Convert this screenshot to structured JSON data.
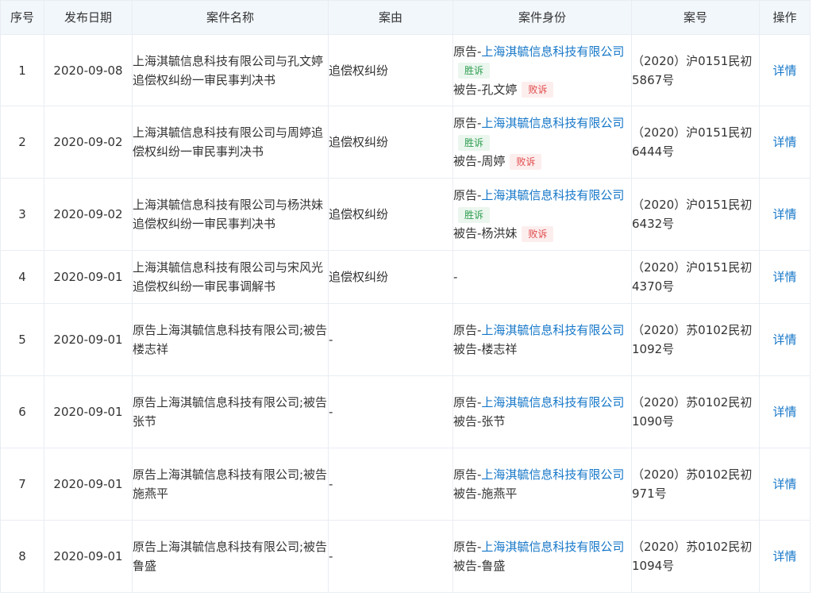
{
  "headers": {
    "idx": "序号",
    "date": "发布日期",
    "name": "案件名称",
    "reason": "案由",
    "role": "案件身份",
    "caseno": "案号",
    "op": "操作"
  },
  "rows": [
    {
      "idx": "1",
      "date": "2020-09-08",
      "name": "上海淇毓信息科技有限公司与孔文婷追偿权纠纷一审民事判决书",
      "reason": "追偿权纠纷",
      "plaintiff_prefix": "原告-",
      "plaintiff": "上海淇毓信息科技有限公司",
      "plaintiff_tag": "胜诉",
      "defendant": "被告-孔文婷",
      "defendant_tag": "败诉",
      "role_text": "",
      "caseno": "（2020）沪0151民初5867号",
      "op": "详情"
    },
    {
      "idx": "2",
      "date": "2020-09-02",
      "name": "上海淇毓信息科技有限公司与周婷追偿权纠纷一审民事判决书",
      "reason": "追偿权纠纷",
      "plaintiff_prefix": "原告-",
      "plaintiff": "上海淇毓信息科技有限公司",
      "plaintiff_tag": "胜诉",
      "defendant": "被告-周婷",
      "defendant_tag": "败诉",
      "role_text": "",
      "caseno": "（2020）沪0151民初6444号",
      "op": "详情"
    },
    {
      "idx": "3",
      "date": "2020-09-02",
      "name": "上海淇毓信息科技有限公司与杨洪妹追偿权纠纷一审民事判决书",
      "reason": "追偿权纠纷",
      "plaintiff_prefix": "原告-",
      "plaintiff": "上海淇毓信息科技有限公司",
      "plaintiff_tag": "胜诉",
      "defendant": "被告-杨洪妹",
      "defendant_tag": "败诉",
      "role_text": "",
      "caseno": "（2020）沪0151民初6432号",
      "op": "详情"
    },
    {
      "idx": "4",
      "date": "2020-09-01",
      "name": "上海淇毓信息科技有限公司与宋风光追偿权纠纷一审民事调解书",
      "reason": "追偿权纠纷",
      "plaintiff_prefix": "",
      "plaintiff": "",
      "plaintiff_tag": "",
      "defendant": "",
      "defendant_tag": "",
      "role_text": "-",
      "caseno": "（2020）沪0151民初4370号",
      "op": "详情"
    },
    {
      "idx": "5",
      "date": "2020-09-01",
      "name": "原告上海淇毓信息科技有限公司;被告楼志祥",
      "reason": "-",
      "plaintiff_prefix": "原告-",
      "plaintiff": "上海淇毓信息科技有限公司",
      "plaintiff_tag": "",
      "defendant": "被告-楼志祥",
      "defendant_tag": "",
      "role_text": "",
      "caseno": "（2020）苏0102民初1092号",
      "op": "详情"
    },
    {
      "idx": "6",
      "date": "2020-09-01",
      "name": "原告上海淇毓信息科技有限公司;被告张节",
      "reason": "-",
      "plaintiff_prefix": "原告-",
      "plaintiff": "上海淇毓信息科技有限公司",
      "plaintiff_tag": "",
      "defendant": "被告-张节",
      "defendant_tag": "",
      "role_text": "",
      "caseno": "（2020）苏0102民初1090号",
      "op": "详情"
    },
    {
      "idx": "7",
      "date": "2020-09-01",
      "name": "原告上海淇毓信息科技有限公司;被告施燕平",
      "reason": "-",
      "plaintiff_prefix": "原告-",
      "plaintiff": "上海淇毓信息科技有限公司",
      "plaintiff_tag": "",
      "defendant": "被告-施燕平",
      "defendant_tag": "",
      "role_text": "",
      "caseno": "（2020）苏0102民初971号",
      "op": "详情"
    },
    {
      "idx": "8",
      "date": "2020-09-01",
      "name": "原告上海淇毓信息科技有限公司;被告鲁盛",
      "reason": "-",
      "plaintiff_prefix": "原告-",
      "plaintiff": "上海淇毓信息科技有限公司",
      "plaintiff_tag": "",
      "defendant": "被告-鲁盛",
      "defendant_tag": "",
      "role_text": "",
      "caseno": "（2020）苏0102民初1094号",
      "op": "详情"
    }
  ]
}
